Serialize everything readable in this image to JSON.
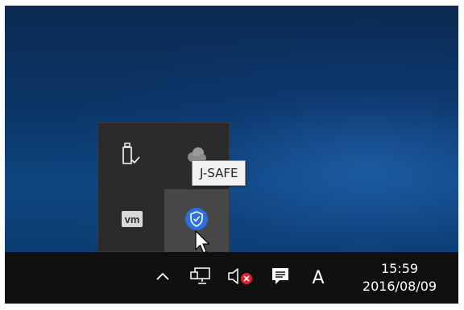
{
  "tooltip": {
    "text": "J-SAFE"
  },
  "overflow_tray": {
    "icons": [
      {
        "name": "safely-remove-hardware-icon",
        "state": "normal"
      },
      {
        "name": "onedrive-cloud-icon",
        "state": "normal"
      },
      {
        "name": "vmware-tools-icon",
        "label": "vm",
        "state": "normal"
      },
      {
        "name": "j-safe-shield-icon",
        "state": "hovered"
      }
    ]
  },
  "taskbar": {
    "icons": [
      {
        "name": "show-hidden-icons-chevron-up-icon"
      },
      {
        "name": "network-icon"
      },
      {
        "name": "volume-muted-icon"
      },
      {
        "name": "action-center-icon"
      }
    ],
    "ime_label": "A",
    "clock": {
      "time": "15:59",
      "date": "2016/08/09"
    }
  },
  "colors": {
    "taskbar_bg": "#101010",
    "flyout_bg": "#2b2b2b",
    "hover_bg": "#474747",
    "shield_blue": "#2d6fe0",
    "mute_red": "#e0232e",
    "tooltip_bg": "#f2f2f2"
  }
}
